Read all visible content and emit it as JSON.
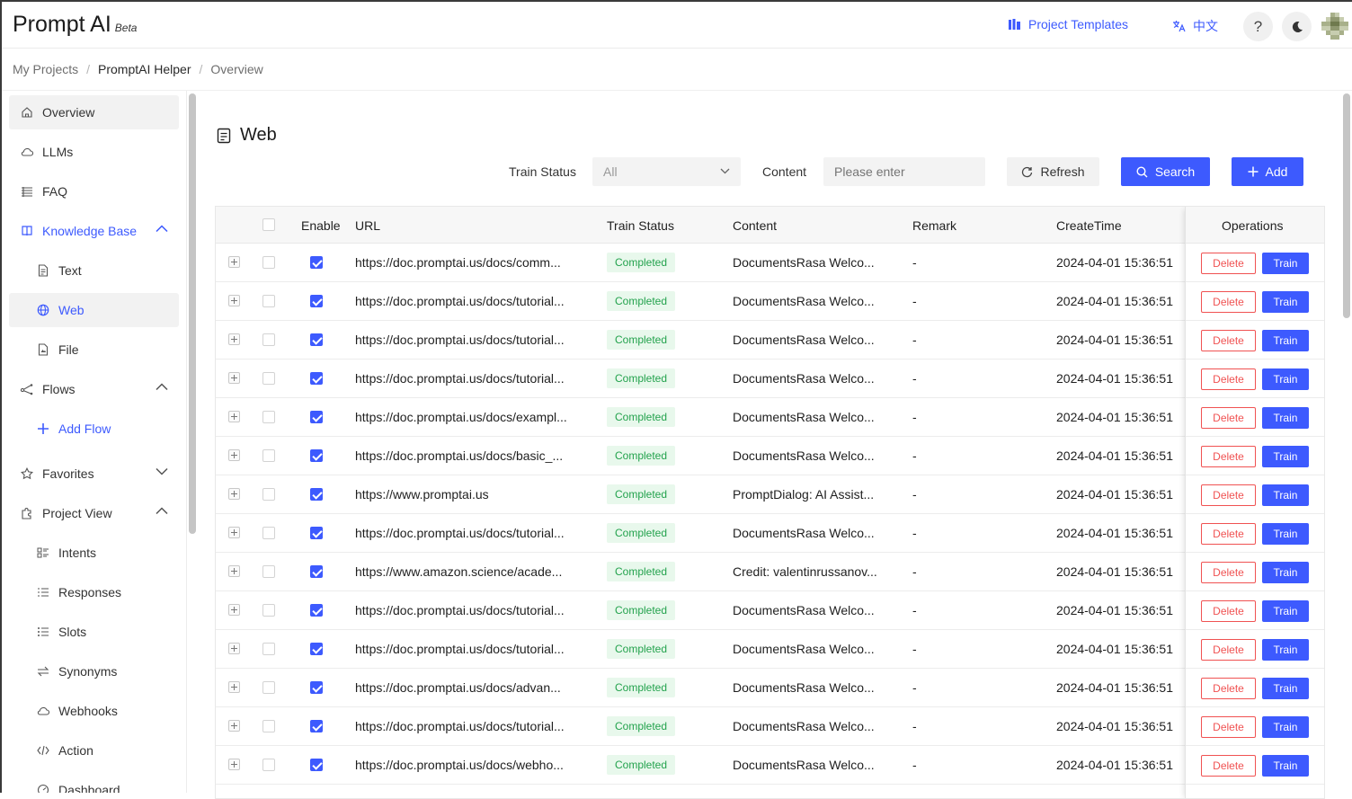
{
  "header": {
    "logo": "Prompt AI",
    "beta": "Beta",
    "templates_label": "Project Templates",
    "lang_label": "中文",
    "help_label": "?"
  },
  "breadcrumb": [
    "My Projects",
    "PromptAI Helper",
    "Overview"
  ],
  "sidebar": {
    "items": [
      {
        "label": "Overview",
        "icon": "home-icon"
      },
      {
        "label": "LLMs",
        "icon": "cloud-icon"
      },
      {
        "label": "FAQ",
        "icon": "faq-icon"
      },
      {
        "label": "Knowledge Base",
        "icon": "book-icon"
      },
      {
        "label": "Text",
        "icon": "text-file-icon"
      },
      {
        "label": "Web",
        "icon": "globe-icon"
      },
      {
        "label": "File",
        "icon": "file-icon"
      },
      {
        "label": "Flows",
        "icon": "flow-icon"
      },
      {
        "label": "Add Flow",
        "icon": "plus-icon"
      },
      {
        "label": "Favorites",
        "icon": "star-icon"
      },
      {
        "label": "Project View",
        "icon": "puzzle-icon"
      },
      {
        "label": "Intents",
        "icon": "intents-icon"
      },
      {
        "label": "Responses",
        "icon": "responses-icon"
      },
      {
        "label": "Slots",
        "icon": "slots-icon"
      },
      {
        "label": "Synonyms",
        "icon": "swap-icon"
      },
      {
        "label": "Webhooks",
        "icon": "cloud-icon"
      },
      {
        "label": "Action",
        "icon": "code-icon"
      },
      {
        "label": "Dashboard",
        "icon": "dashboard-icon"
      }
    ]
  },
  "page": {
    "title": "Web",
    "train_status_label": "Train Status",
    "train_status_value": "All",
    "content_label": "Content",
    "content_placeholder": "Please enter",
    "refresh_label": "Refresh",
    "search_label": "Search",
    "add_label": "Add"
  },
  "table": {
    "columns": [
      "Enable",
      "URL",
      "Train Status",
      "Content",
      "Remark",
      "CreateTime",
      "Operations"
    ],
    "delete_label": "Delete",
    "train_label": "Train",
    "rows": [
      {
        "url": "https://doc.promptai.us/docs/comm...",
        "status": "Completed",
        "content": "DocumentsRasa Welco...",
        "remark": "-",
        "time": "2024-04-01 15:36:51"
      },
      {
        "url": "https://doc.promptai.us/docs/tutorial...",
        "status": "Completed",
        "content": "DocumentsRasa Welco...",
        "remark": "-",
        "time": "2024-04-01 15:36:51"
      },
      {
        "url": "https://doc.promptai.us/docs/tutorial...",
        "status": "Completed",
        "content": "DocumentsRasa Welco...",
        "remark": "-",
        "time": "2024-04-01 15:36:51"
      },
      {
        "url": "https://doc.promptai.us/docs/tutorial...",
        "status": "Completed",
        "content": "DocumentsRasa Welco...",
        "remark": "-",
        "time": "2024-04-01 15:36:51"
      },
      {
        "url": "https://doc.promptai.us/docs/exampl...",
        "status": "Completed",
        "content": "DocumentsRasa Welco...",
        "remark": "-",
        "time": "2024-04-01 15:36:51"
      },
      {
        "url": "https://doc.promptai.us/docs/basic_...",
        "status": "Completed",
        "content": "DocumentsRasa Welco...",
        "remark": "-",
        "time": "2024-04-01 15:36:51"
      },
      {
        "url": "https://www.promptai.us",
        "status": "Completed",
        "content": "PromptDialog: AI Assist...",
        "remark": "-",
        "time": "2024-04-01 15:36:51"
      },
      {
        "url": "https://doc.promptai.us/docs/tutorial...",
        "status": "Completed",
        "content": "DocumentsRasa Welco...",
        "remark": "-",
        "time": "2024-04-01 15:36:51"
      },
      {
        "url": "https://www.amazon.science/acade...",
        "status": "Completed",
        "content": "Credit: valentinrussanov...",
        "remark": "-",
        "time": "2024-04-01 15:36:51"
      },
      {
        "url": "https://doc.promptai.us/docs/tutorial...",
        "status": "Completed",
        "content": "DocumentsRasa Welco...",
        "remark": "-",
        "time": "2024-04-01 15:36:51"
      },
      {
        "url": "https://doc.promptai.us/docs/tutorial...",
        "status": "Completed",
        "content": "DocumentsRasa Welco...",
        "remark": "-",
        "time": "2024-04-01 15:36:51"
      },
      {
        "url": "https://doc.promptai.us/docs/advan...",
        "status": "Completed",
        "content": "DocumentsRasa Welco...",
        "remark": "-",
        "time": "2024-04-01 15:36:51"
      },
      {
        "url": "https://doc.promptai.us/docs/tutorial...",
        "status": "Completed",
        "content": "DocumentsRasa Welco...",
        "remark": "-",
        "time": "2024-04-01 15:36:51"
      },
      {
        "url": "https://doc.promptai.us/docs/webho...",
        "status": "Completed",
        "content": "DocumentsRasa Welco...",
        "remark": "-",
        "time": "2024-04-01 15:36:51"
      }
    ]
  },
  "colors": {
    "accent": "#3d5afe",
    "success": "#23a24d",
    "danger": "#f05252"
  }
}
